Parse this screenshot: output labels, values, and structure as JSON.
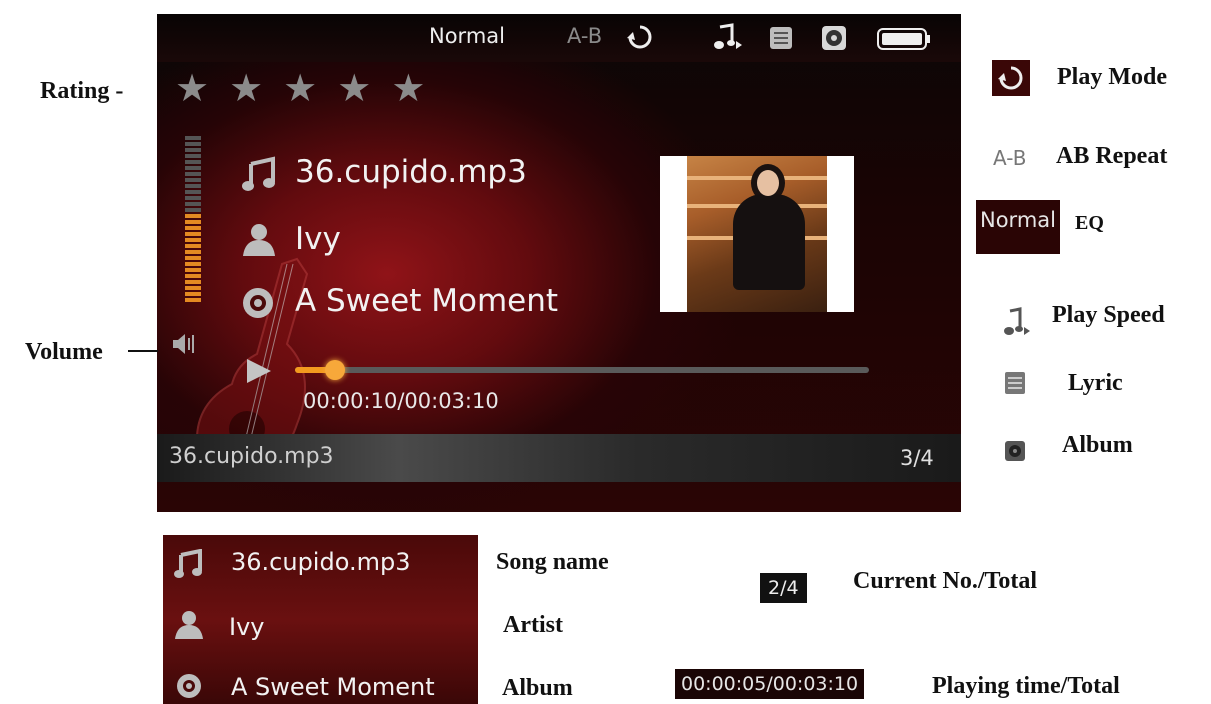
{
  "player": {
    "eq": "Normal",
    "ab": "A-B",
    "rating_stars": 5,
    "rating_filled": 0,
    "song": "36.cupido.mp3",
    "artist": "Ivy",
    "album": "A Sweet Moment",
    "time": "00:00:10/00:03:10",
    "progress_fraction": 0.07,
    "volume_fraction": 0.55,
    "bottom_file": "36.cupido.mp3",
    "bottom_count": "3/4"
  },
  "legend": {
    "rating": "Rating -",
    "volume": "Volume",
    "play_mode": "Play Mode",
    "ab_icon": "A-B",
    "ab_repeat": "AB Repeat",
    "eq_chip": "Normal",
    "eq": "EQ",
    "play_speed": "Play Speed",
    "lyric": "Lyric",
    "album": "Album"
  },
  "detail": {
    "song": "36.cupido.mp3",
    "artist": "Ivy",
    "album": "A Sweet Moment",
    "song_label": "Song name",
    "artist_label": "Artist",
    "album_label": "Album"
  },
  "counters": {
    "count_chip": "2/4",
    "count_label": "Current No./Total",
    "time_chip": "00:00:05/00:03:10",
    "time_label": "Playing time/Total"
  },
  "colors": {
    "accent": "#f39a1f",
    "panel": "#5a0a0a"
  }
}
